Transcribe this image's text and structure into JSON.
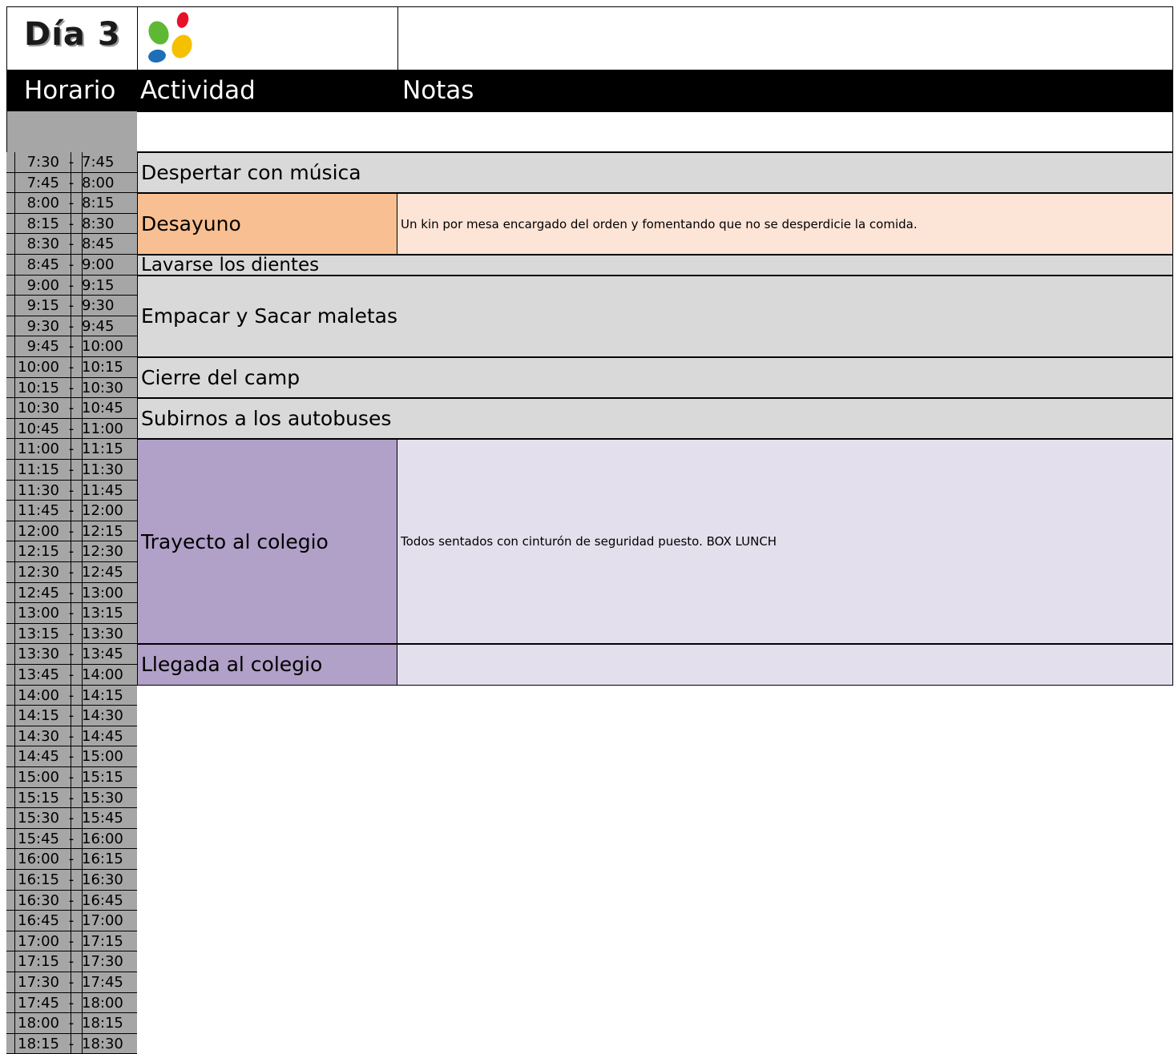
{
  "title": "Día 3",
  "header": {
    "horario": "Horario",
    "actividad": "Actividad",
    "notas": "Notas"
  },
  "logo": {
    "icon": "colored-dots-logo",
    "colors": [
      "#e8102a",
      "#5fb833",
      "#1e6fb8",
      "#f5c000"
    ]
  },
  "times": [
    {
      "start": "7:30",
      "end": "7:45"
    },
    {
      "start": "7:45",
      "end": "8:00"
    },
    {
      "start": "8:00",
      "end": "8:15"
    },
    {
      "start": "8:15",
      "end": "8:30"
    },
    {
      "start": "8:30",
      "end": "8:45"
    },
    {
      "start": "8:45",
      "end": "9:00"
    },
    {
      "start": "9:00",
      "end": "9:15"
    },
    {
      "start": "9:15",
      "end": "9:30"
    },
    {
      "start": "9:30",
      "end": "9:45"
    },
    {
      "start": "9:45",
      "end": "10:00"
    },
    {
      "start": "10:00",
      "end": "10:15"
    },
    {
      "start": "10:15",
      "end": "10:30"
    },
    {
      "start": "10:30",
      "end": "10:45"
    },
    {
      "start": "10:45",
      "end": "11:00"
    },
    {
      "start": "11:00",
      "end": "11:15"
    },
    {
      "start": "11:15",
      "end": "11:30"
    },
    {
      "start": "11:30",
      "end": "11:45"
    },
    {
      "start": "11:45",
      "end": "12:00"
    },
    {
      "start": "12:00",
      "end": "12:15"
    },
    {
      "start": "12:15",
      "end": "12:30"
    },
    {
      "start": "12:30",
      "end": "12:45"
    },
    {
      "start": "12:45",
      "end": "13:00"
    },
    {
      "start": "13:00",
      "end": "13:15"
    },
    {
      "start": "13:15",
      "end": "13:30"
    },
    {
      "start": "13:30",
      "end": "13:45"
    },
    {
      "start": "13:45",
      "end": "14:00"
    },
    {
      "start": "14:00",
      "end": "14:15"
    },
    {
      "start": "14:15",
      "end": "14:30"
    },
    {
      "start": "14:30",
      "end": "14:45"
    },
    {
      "start": "14:45",
      "end": "15:00"
    },
    {
      "start": "15:00",
      "end": "15:15"
    },
    {
      "start": "15:15",
      "end": "15:30"
    },
    {
      "start": "15:30",
      "end": "15:45"
    },
    {
      "start": "15:45",
      "end": "16:00"
    },
    {
      "start": "16:00",
      "end": "16:15"
    },
    {
      "start": "16:15",
      "end": "16:30"
    },
    {
      "start": "16:30",
      "end": "16:45"
    },
    {
      "start": "16:45",
      "end": "17:00"
    },
    {
      "start": "17:00",
      "end": "17:15"
    },
    {
      "start": "17:15",
      "end": "17:30"
    },
    {
      "start": "17:30",
      "end": "17:45"
    },
    {
      "start": "17:45",
      "end": "18:00"
    },
    {
      "start": "18:00",
      "end": "18:15"
    },
    {
      "start": "18:15",
      "end": "18:30"
    }
  ],
  "activities": [
    {
      "name": "Despertar con música",
      "note": "",
      "slots": 2,
      "act_color": "#d9d9d9",
      "note_color": "#d9d9d9",
      "full_width": true
    },
    {
      "name": "Desayuno",
      "note": "Un kin por mesa encargado del orden y fomentando que no se desperdicie la comida.",
      "slots": 3,
      "act_color": "#f8bf92",
      "note_color": "#fce4d6",
      "full_width": false
    },
    {
      "name": "Lavarse los dientes",
      "note": "",
      "slots": 1,
      "act_color": "#d9d9d9",
      "note_color": "#d9d9d9",
      "full_width": true
    },
    {
      "name": "Empacar y Sacar maletas",
      "note": "",
      "slots": 4,
      "act_color": "#d9d9d9",
      "note_color": "#d9d9d9",
      "full_width": true
    },
    {
      "name": "Cierre del camp",
      "note": "",
      "slots": 2,
      "act_color": "#d9d9d9",
      "note_color": "#d9d9d9",
      "full_width": true
    },
    {
      "name": "Subirnos a los autobuses",
      "note": "",
      "slots": 2,
      "act_color": "#d9d9d9",
      "note_color": "#d9d9d9",
      "full_width": true
    },
    {
      "name": "Trayecto al colegio",
      "note": "Todos sentados con cinturón de seguridad puesto. BOX LUNCH",
      "slots": 10,
      "act_color": "#b1a0c7",
      "note_color": "#e4dfec",
      "full_width": false
    },
    {
      "name": "Llegada al colegio",
      "note": "",
      "slots": 2,
      "act_color": "#b1a0c7",
      "note_color": "#e4dfec",
      "full_width": false
    }
  ]
}
